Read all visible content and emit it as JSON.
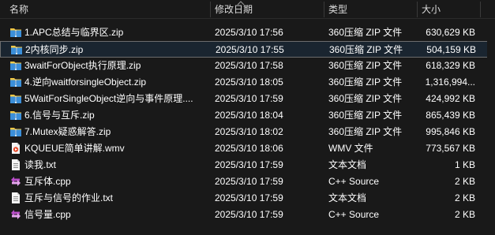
{
  "columns": {
    "name": "名称",
    "date": "修改日期",
    "type": "类型",
    "size": "大小"
  },
  "colors": {
    "zip_folder": "#f2c744",
    "zip_zipper": "#3b8fd9",
    "cpp_icon": "#b84cc7",
    "text_white": "#ffffff",
    "selected_border": "#6d6d6d"
  },
  "files": [
    {
      "name": "1.APC总结与临界区.zip",
      "date": "2025/3/10 17:56",
      "type": "360压缩 ZIP 文件",
      "size": "630,629 KB",
      "icon": "zip-icon"
    },
    {
      "name": "2内核同步.zip",
      "date": "2025/3/10 17:55",
      "type": "360压缩 ZIP 文件",
      "size": "504,159 KB",
      "icon": "zip-icon",
      "selected": true
    },
    {
      "name": "3waitForObject执行原理.zip",
      "date": "2025/3/10 17:58",
      "type": "360压缩 ZIP 文件",
      "size": "618,329 KB",
      "icon": "zip-icon"
    },
    {
      "name": "4.逆向waitforsingleObject.zip",
      "date": "2025/3/10 18:05",
      "type": "360压缩 ZIP 文件",
      "size": "1,316,994...",
      "icon": "zip-icon"
    },
    {
      "name": "5WaitForSingleObject逆向与事件原理....",
      "date": "2025/3/10 17:59",
      "type": "360压缩 ZIP 文件",
      "size": "424,992 KB",
      "icon": "zip-icon"
    },
    {
      "name": "6.信号与互斥.zip",
      "date": "2025/3/10 18:04",
      "type": "360压缩 ZIP 文件",
      "size": "865,439 KB",
      "icon": "zip-icon"
    },
    {
      "name": "7.Mutex疑惑解答.zip",
      "date": "2025/3/10 18:02",
      "type": "360压缩 ZIP 文件",
      "size": "995,846 KB",
      "icon": "zip-icon"
    },
    {
      "name": "KQUEUE简单讲解.wmv",
      "date": "2025/3/10 18:06",
      "type": "WMV 文件",
      "size": "773,567 KB",
      "icon": "video-file-icon"
    },
    {
      "name": "读我.txt",
      "date": "2025/3/10 17:59",
      "type": "文本文档",
      "size": "1 KB",
      "icon": "text-file-icon"
    },
    {
      "name": "互斥体.cpp",
      "date": "2025/3/10 17:59",
      "type": "C++ Source",
      "size": "2 KB",
      "icon": "cpp-file-icon"
    },
    {
      "name": "互斥与信号的作业.txt",
      "date": "2025/3/10 17:59",
      "type": "文本文档",
      "size": "2 KB",
      "icon": "text-file-icon"
    },
    {
      "name": "信号量.cpp",
      "date": "2025/3/10 17:59",
      "type": "C++ Source",
      "size": "2 KB",
      "icon": "cpp-file-icon"
    }
  ]
}
